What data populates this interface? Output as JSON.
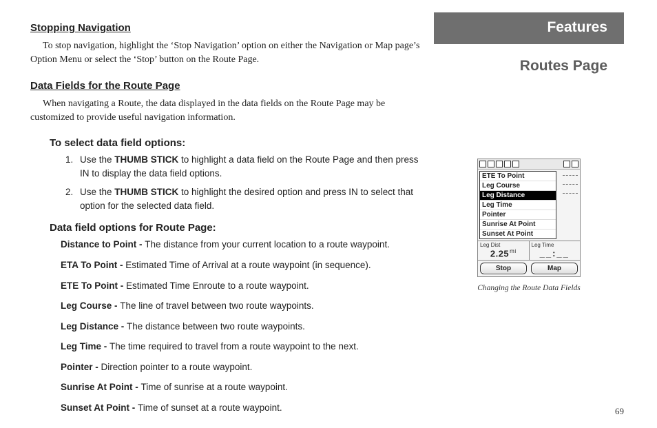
{
  "header": {
    "features": "Features",
    "section": "Routes Page"
  },
  "leftcol": {
    "stop_nav_h": "Stopping Navigation",
    "stop_nav_body": "To stop navigation, highlight the ‘Stop Navigation’ option on either the Navigation or Map page’s Option Menu or select the ‘Stop’ button on the Route Page.",
    "data_fields_h": "Data Fields for the Route Page",
    "data_fields_body": "When navigating a Route, the data displayed in the data fields on the Route Page may be customized to provide useful navigation information.",
    "select_h": "To select data field options:",
    "thumb_stick": "THUMB STICK",
    "step1_a": "Use the ",
    "step1_b": " to highlight a data field on the Route Page and then press IN to display the data field options.",
    "step2_a": "Use the ",
    "step2_b": " to highlight the desired option and press IN to select that option for the selected data field.",
    "opts_h": "Data field options for Route Page:",
    "defs": [
      {
        "term": "Distance to Point - ",
        "desc": "The distance from your current location to a route waypoint."
      },
      {
        "term": "ETA To Point - ",
        "desc": "Estimated Time of Arrival at a route waypoint (in sequence)."
      },
      {
        "term": "ETE To Point - ",
        "desc": "Estimated Time Enroute to a route waypoint."
      },
      {
        "term": "Leg Course - ",
        "desc": "The line of travel between two route waypoints."
      },
      {
        "term": "Leg Distance - ",
        "desc": "The distance between two route waypoints."
      },
      {
        "term": "Leg Time - ",
        "desc": "The time required to travel from a route waypoint to the next."
      },
      {
        "term": "Pointer - ",
        "desc": "Direction pointer to a route waypoint."
      },
      {
        "term": "Sunrise At Point - ",
        "desc": "Time of sunrise at a route waypoint."
      },
      {
        "term": "Sunset At Point - ",
        "desc": "Time of sunset at a route waypoint."
      }
    ]
  },
  "device": {
    "menu": [
      "ETE To Point",
      "Leg Course",
      "Leg Distance",
      "Leg Time",
      "Pointer",
      "Sunrise At Point",
      "Sunset At Point"
    ],
    "selected_index": 2,
    "field1_label": "Leg Dist",
    "field1_value": "2.25",
    "field1_unit": "mi",
    "field2_label": "Leg Time",
    "field2_value": "__:__",
    "btn_stop": "Stop",
    "btn_map": "Map"
  },
  "caption": "Changing the Route Data Fields",
  "page_number": "69"
}
